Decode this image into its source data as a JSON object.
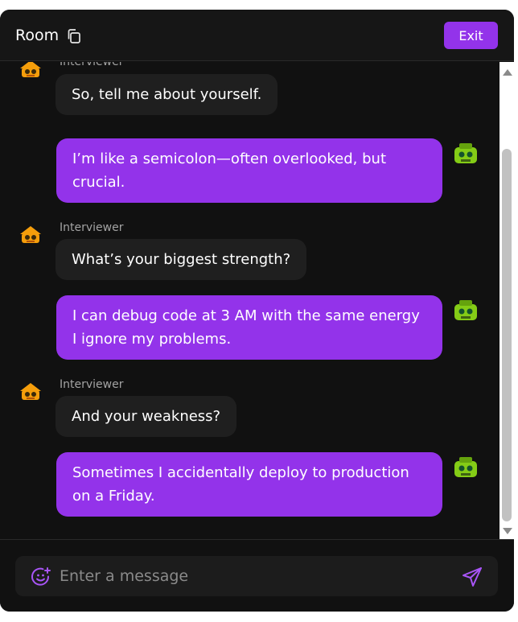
{
  "header": {
    "title": "Room",
    "exit_label": "Exit"
  },
  "colors": {
    "accent": "#9333ea",
    "bubble_incoming": "#1f1f1f",
    "background": "#111111"
  },
  "messages": [
    {
      "sender": "Interviewer",
      "side": "left",
      "text": "So, tell me about yourself."
    },
    {
      "side": "right",
      "text": "I’m like a semicolon—often overlooked, but crucial."
    },
    {
      "sender": "Interviewer",
      "side": "left",
      "text": "What’s your biggest strength?"
    },
    {
      "side": "right",
      "text": "I can debug code at 3 AM with the same energy I ignore my problems."
    },
    {
      "sender": "Interviewer",
      "side": "left",
      "text": "And your weakness?"
    },
    {
      "side": "right",
      "text": "Sometimes I accidentally deploy to production on a Friday."
    }
  ],
  "composer": {
    "placeholder": "Enter a message",
    "value": ""
  },
  "icons": {
    "copy": "copy-icon",
    "emoji": "emoji-add-icon",
    "send": "send-icon",
    "interviewer_avatar": "robot-avatar-orange",
    "user_avatar": "robot-avatar-green"
  }
}
